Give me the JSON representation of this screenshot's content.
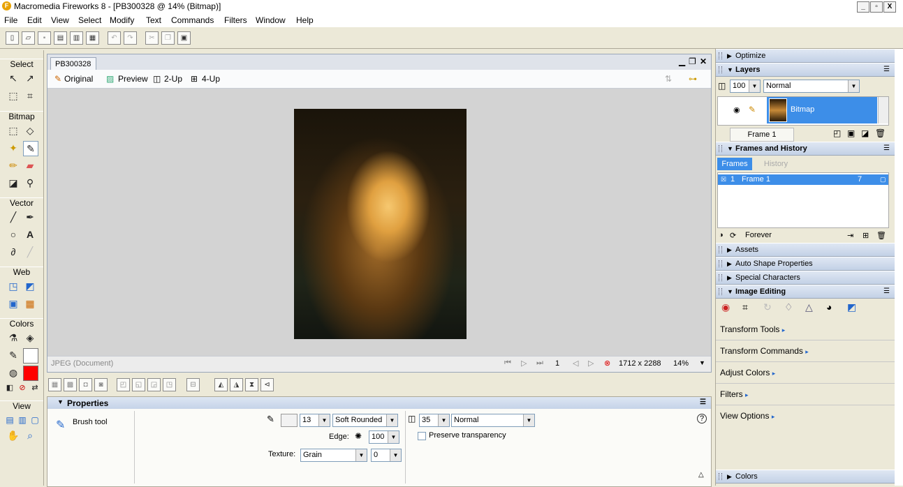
{
  "window": {
    "title": "Macromedia Fireworks 8 - [PB300328 @ 14% (Bitmap)]",
    "app_badge": "F",
    "minimize": "_",
    "restore": "▫",
    "close": "X"
  },
  "menu": [
    "File",
    "Edit",
    "View",
    "Select",
    "Modify",
    "Text",
    "Commands",
    "Filters",
    "Window",
    "Help"
  ],
  "tools": {
    "sections": [
      "Select",
      "Bitmap",
      "Vector",
      "Web",
      "Colors",
      "View"
    ]
  },
  "document": {
    "tab": "PB300328",
    "modes": [
      "Original",
      "Preview",
      "2-Up",
      "4-Up"
    ],
    "status_left": "JPEG (Document)",
    "frame_number": "1",
    "size": "1712 x 2288",
    "zoom": "14%"
  },
  "properties": {
    "header": "Properties",
    "tool_name": "Brush tool",
    "stroke_size": "13",
    "stroke_category": "Soft Rounded",
    "edge_label": "Edge:",
    "edge_value": "100",
    "texture_label": "Texture:",
    "texture_value": "Grain",
    "texture_amount": "0",
    "opacity": "35",
    "blend_mode": "Normal",
    "preserve_transparency": "Preserve transparency",
    "help": "?"
  },
  "panels": {
    "optimize": "Optimize",
    "layers": "Layers",
    "layer_opacity": "100",
    "layer_blend": "Normal",
    "layer_name": "Bitmap",
    "frame_label": "Frame 1",
    "frames_history": "Frames and History",
    "tab_frames": "Frames",
    "tab_history": "History",
    "frame_row_index": "1",
    "frame_row_name": "Frame 1",
    "frame_row_delay": "7",
    "loop": "Forever",
    "assets": "Assets",
    "auto_shape": "Auto Shape Properties",
    "special_chars": "Special Characters",
    "image_editing": "Image Editing",
    "image_editing_items": [
      "Transform Tools",
      "Transform Commands",
      "Adjust Colors",
      "Filters",
      "View Options"
    ],
    "colors": "Colors"
  },
  "colors": {
    "selection": "#3d8ee8",
    "stroke_red": "#ff0000",
    "panel_header": "#c3d1e6"
  }
}
